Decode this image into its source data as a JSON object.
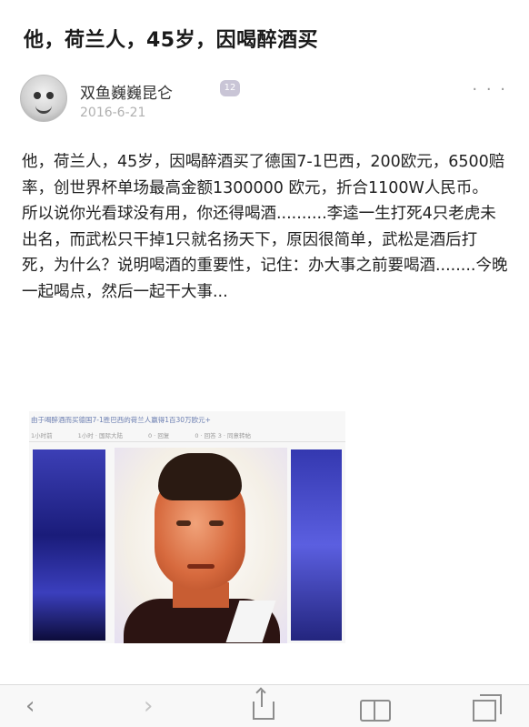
{
  "post": {
    "title": "他，荷兰人，45岁，因喝醉酒买",
    "author": {
      "name": "双鱼巍巍昆仑",
      "badge": "12",
      "date": "2016-6-21"
    },
    "more_icon": "more-dots-icon",
    "paragraphs": [
      "他，荷兰人，45岁，因喝醉酒买了德国7-1巴西，200欧元，6500赔率，创世界杯单场最高金额1300000 欧元，折合1100W人民币。",
      "所以说你光看球没有用，你还得喝酒..........李逵一生打死4只老虎未出名，而武松只干掉1只就名扬天下，原因很简单，武松是酒后打死，为什么？说明喝酒的重要性，记住：办大事之前要喝酒........今晚一起喝点，然后一起干大事..."
    ],
    "embedded_screenshot": {
      "caption": "由于喝醉酒而买德国7-1胜巴西的荷兰人赢得1百30万欧元+",
      "meta": [
        "1小时前",
        "1小时 · 国际大陆",
        "0 · 回复",
        "0 · 回答 3 · 同意转帖"
      ]
    }
  },
  "browser_toolbar": {
    "back_icon": "back-arrow-icon",
    "forward_icon": "forward-arrow-icon",
    "share_icon": "share-icon",
    "bookmarks_icon": "bookmarks-icon",
    "tabs_icon": "tabs-icon"
  }
}
